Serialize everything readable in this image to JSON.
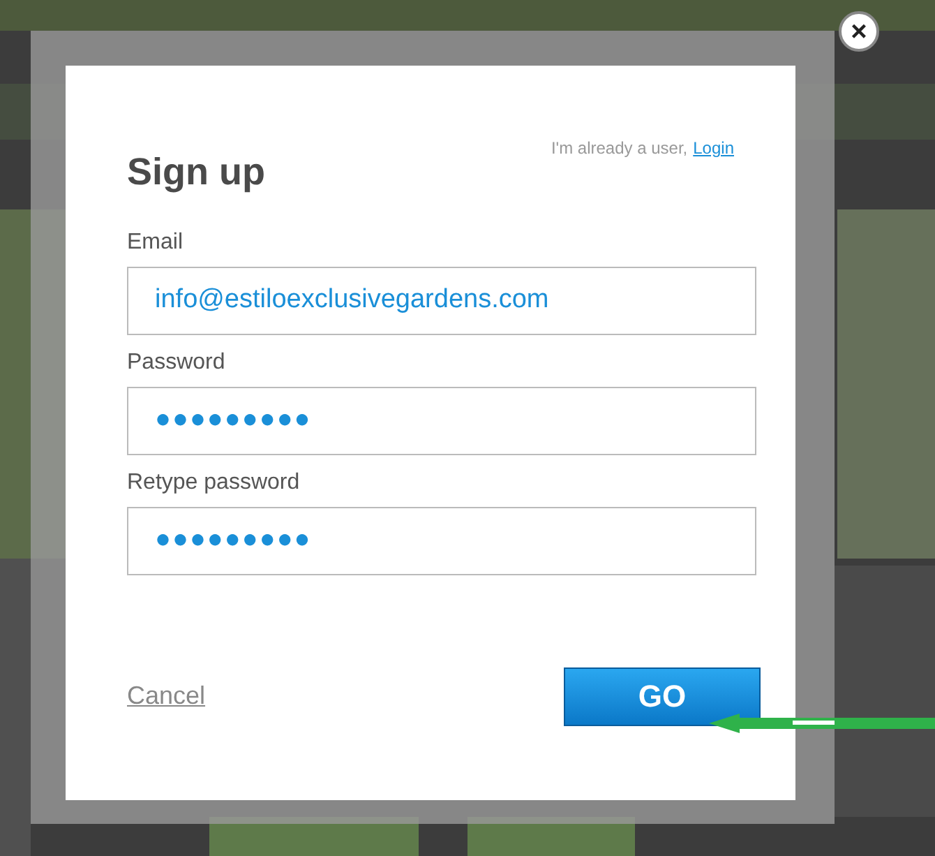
{
  "dialog": {
    "title": "Sign up",
    "login_prompt": "I'm already a user,",
    "login_link": "Login",
    "fields": [
      {
        "label": "Email",
        "kind": "text",
        "value": "info@estiloexclusivegardens.com"
      },
      {
        "label": "Password",
        "kind": "secret",
        "value": "●●●●●●●●●"
      },
      {
        "label": "Retype password",
        "kind": "secret",
        "value": "●●●●●●●●●"
      }
    ],
    "cancel": "Cancel",
    "submit": "GO",
    "close": "×"
  },
  "annotation": {
    "kind": "arrow"
  }
}
